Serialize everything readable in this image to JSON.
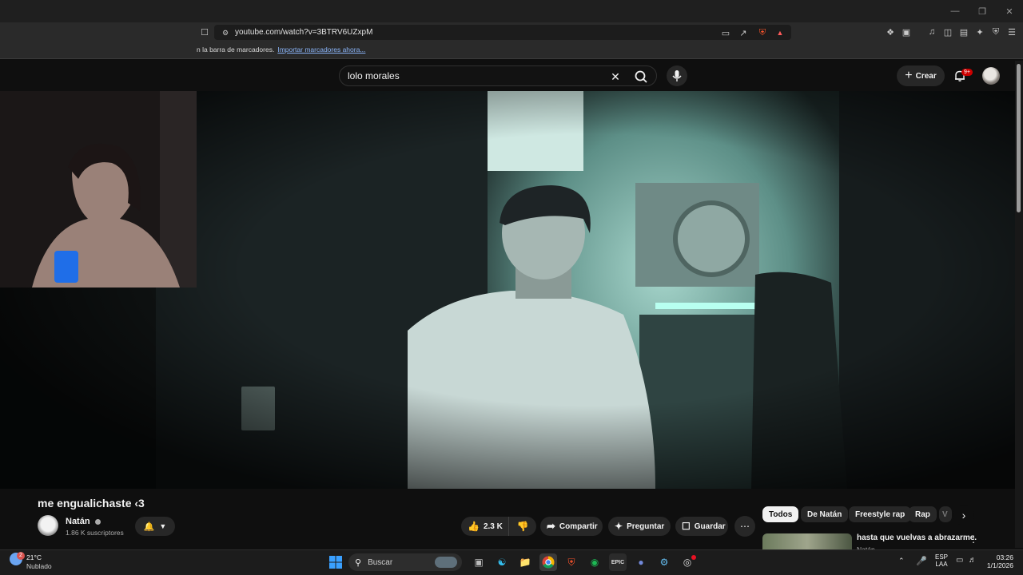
{
  "browser": {
    "url": "youtube.com/watch?v=3BTRV6UZxpM",
    "bookmarks_text": "n la barra de marcadores.",
    "bookmarks_link": "Importar marcadores ahora..."
  },
  "youtube": {
    "search_value": "lolo morales",
    "create_label": "Crear",
    "notif_badge": "9+",
    "video_title": "me engualichaste ‹3",
    "channel_name": "Natán",
    "channel_subs": "1.86 K suscriptores",
    "likes": "2.3 K",
    "share_label": "Compartir",
    "ask_label": "Preguntar",
    "save_label": "Guardar",
    "chips": [
      "Todos",
      "De Natán",
      "Freestyle rap",
      "Rap",
      "V"
    ],
    "related_title": "hasta que vuelvas a abrazarme.",
    "related_channel": "Natán"
  },
  "taskbar": {
    "weather_temp": "21°C",
    "weather_desc": "Nublado",
    "weather_badge": "2",
    "search_placeholder": "Buscar",
    "lang_top": "ESP",
    "lang_bottom": "LAA",
    "time": "03:26",
    "date": "1/1/2026",
    "epic_label": "EPIC"
  }
}
